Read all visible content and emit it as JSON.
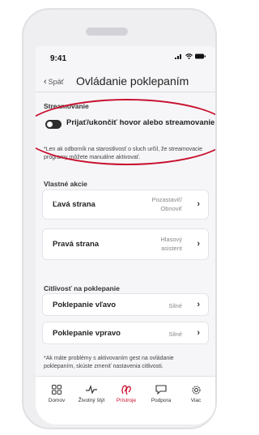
{
  "status": {
    "time": "9:41"
  },
  "header": {
    "back": "Späť",
    "title": "Ovládanie poklepaním"
  },
  "streaming": {
    "section": "Streamovanie",
    "toggle_label": "Prijať/ukončiť hovor alebo streamovanie",
    "toggle_on": false,
    "note": "*Len ak odborník na starostlivosť o sluch určil, že streamovacie programy môžete manuálne aktivovať."
  },
  "own_actions": {
    "section": "Vlastné akcie",
    "items": [
      {
        "label": "Ľavá strana",
        "value_line1": "Pozastaviť/",
        "value_line2": "Obnoviť"
      },
      {
        "label": "Pravá strana",
        "value_line1": "Hlasový",
        "value_line2": "asistent"
      }
    ]
  },
  "sensitivity": {
    "section": "Citlivosť na poklepanie",
    "items": [
      {
        "label": "Poklepanie vľavo",
        "value": "Silné"
      },
      {
        "label": "Poklepanie vpravo",
        "value": "Silné"
      }
    ],
    "note": "*Ak máte problémy s aktivovaním gest na ovládanie poklepaním, skúste zmeniť nastavenia citlivosti."
  },
  "tabs": [
    {
      "label": "Domov",
      "icon": "grid-icon"
    },
    {
      "label": "Životný štýl",
      "icon": "pulse-icon"
    },
    {
      "label": "Prístroje",
      "icon": "hearing-aids-icon",
      "active": true
    },
    {
      "label": "Podpora",
      "icon": "chat-icon"
    },
    {
      "label": "Viac",
      "icon": "gear-icon"
    }
  ],
  "colors": {
    "accent": "#c8102e",
    "annotation": "#c8102e"
  }
}
